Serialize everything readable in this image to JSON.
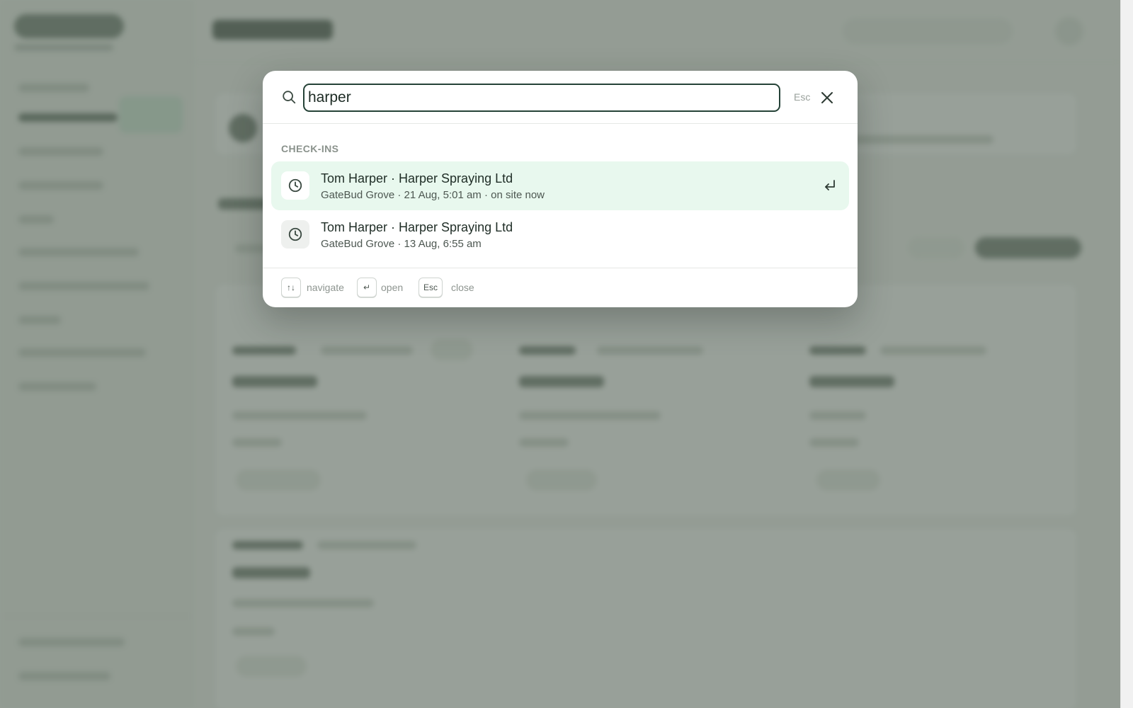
{
  "palette": {
    "search": {
      "value": "harper",
      "esc_hint": "Esc"
    },
    "group_label": "CHECK-INS",
    "results": [
      {
        "title": "Tom Harper · Harper Spraying Ltd",
        "subtitle": "GateBud Grove · 21 Aug, 5:01 am · on site now",
        "icon": "clock-icon",
        "selected": true
      },
      {
        "title": "Tom Harper · Harper Spraying Ltd",
        "subtitle": "GateBud Grove · 13 Aug, 6:55 am",
        "icon": "clock-icon",
        "selected": false
      }
    ],
    "footer": {
      "navigate_key": "↑↓",
      "navigate_label": "navigate",
      "open_key": "↵",
      "open_label": "open",
      "close_key": "Esc",
      "close_label": "close"
    }
  },
  "colors": {
    "accent_border": "#254237",
    "selected_row": "#e8f8ee",
    "overlay": "#58665a"
  }
}
